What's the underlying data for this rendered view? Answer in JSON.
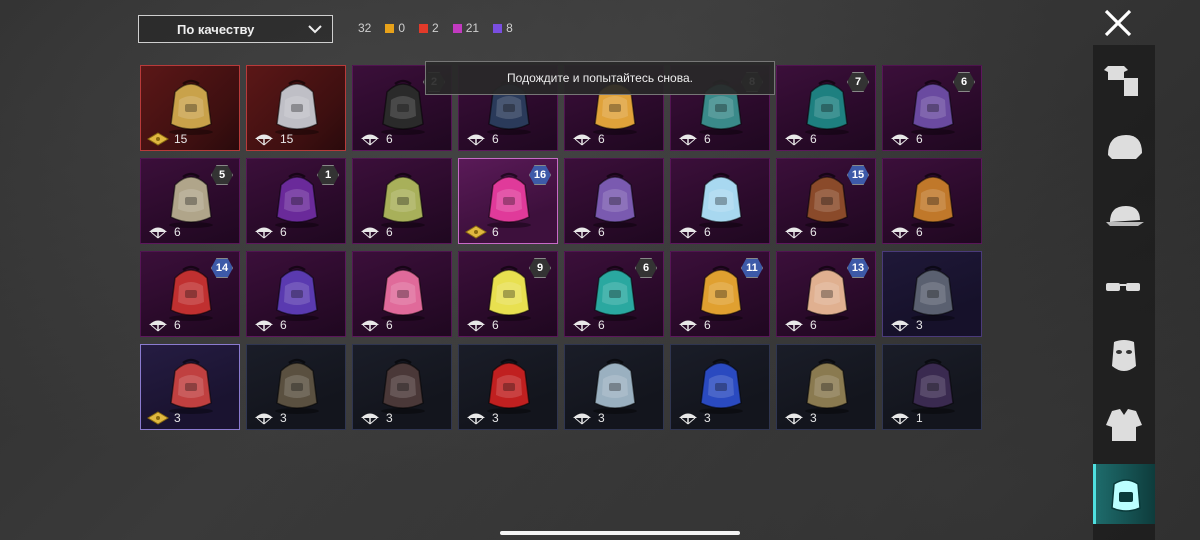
{
  "sort": {
    "label": "По качеству"
  },
  "counts": {
    "total": "32",
    "groups": [
      {
        "value": "0",
        "color": "#e8a21a"
      },
      {
        "value": "2",
        "color": "#e23a2a"
      },
      {
        "value": "21",
        "color": "#c23ac0"
      },
      {
        "value": "8",
        "color": "#7a4ee0"
      }
    ]
  },
  "toast": {
    "text": "Подождите и попытайтесь снова."
  },
  "items": [
    {
      "count": "15",
      "quality": "legendary",
      "currency": "gold",
      "icon": "gold-helmet-emblem",
      "art": "#c9a24a"
    },
    {
      "count": "15",
      "quality": "legendary",
      "currency": "silver",
      "icon": "silver-winged-emblem",
      "art": "#bfbfc6"
    },
    {
      "count": "6",
      "quality": "epic",
      "currency": "silver",
      "icon": "black-pink-backpack",
      "art": "#2a2a2a",
      "level": "2"
    },
    {
      "count": "6",
      "quality": "epic",
      "currency": "silver",
      "icon": "navy-gold-backpack",
      "art": "#2a3a5a"
    },
    {
      "count": "6",
      "quality": "epic",
      "currency": "silver",
      "icon": "bird-costume-backpack",
      "art": "#e0a23a"
    },
    {
      "count": "6",
      "quality": "epic",
      "currency": "silver",
      "icon": "mammoth-backpack",
      "art": "#3a8a8a",
      "level": "8"
    },
    {
      "count": "6",
      "quality": "epic",
      "currency": "silver",
      "icon": "teal-armored-backpack",
      "art": "#1e8080",
      "level": "7"
    },
    {
      "count": "6",
      "quality": "epic",
      "currency": "silver",
      "icon": "purple-shrine-backpack",
      "art": "#6a4aa0",
      "level": "6"
    },
    {
      "count": "6",
      "quality": "epic",
      "currency": "silver",
      "icon": "ornate-beige-backpack",
      "art": "#b0a58a",
      "level": "5"
    },
    {
      "count": "6",
      "quality": "epic",
      "currency": "silver",
      "icon": "purple-cat-backpack",
      "art": "#6a2a9a",
      "level": "1"
    },
    {
      "count": "6",
      "quality": "epic",
      "currency": "silver",
      "icon": "olive-tactical-backpack",
      "art": "#a8b05a"
    },
    {
      "count": "6",
      "quality": "epic-hl",
      "currency": "gold",
      "icon": "pink-robot-backpack",
      "art": "#e03a9a",
      "level": "16"
    },
    {
      "count": "6",
      "quality": "epic",
      "currency": "silver",
      "icon": "purple-ornate-backpack",
      "art": "#7a5ab0"
    },
    {
      "count": "6",
      "quality": "epic",
      "currency": "silver",
      "icon": "snowman-backpack",
      "art": "#a8d8f0"
    },
    {
      "count": "6",
      "quality": "epic",
      "currency": "silver",
      "icon": "camo-orange-backpack",
      "art": "#8a4a2a",
      "level": "15"
    },
    {
      "count": "6",
      "quality": "epic",
      "currency": "silver",
      "icon": "burger-backpack",
      "art": "#c0782a"
    },
    {
      "count": "6",
      "quality": "epic",
      "currency": "silver",
      "icon": "red-turtle-backpack",
      "art": "#c03030",
      "level": "14"
    },
    {
      "count": "6",
      "quality": "epic",
      "currency": "silver",
      "icon": "purple-gold-backpack",
      "art": "#5a3ab0"
    },
    {
      "count": "6",
      "quality": "epic",
      "currency": "silver",
      "icon": "pink-hearts-backpack",
      "art": "#e06a9a"
    },
    {
      "count": "6",
      "quality": "epic",
      "currency": "silver",
      "icon": "bunny-backpack",
      "art": "#e8e050",
      "level": "9"
    },
    {
      "count": "6",
      "quality": "epic",
      "currency": "silver",
      "icon": "teal-dragon-backpack",
      "art": "#2aa8a0",
      "level": "6"
    },
    {
      "count": "6",
      "quality": "epic",
      "currency": "silver",
      "icon": "chicken-backpack",
      "art": "#e0a030",
      "level": "11"
    },
    {
      "count": "6",
      "quality": "epic",
      "currency": "silver",
      "icon": "cake-backpack",
      "art": "#e0b090",
      "level": "13"
    },
    {
      "count": "3",
      "quality": "rare",
      "currency": "silver",
      "icon": "armored-gray-backpack",
      "art": "#5a6070"
    },
    {
      "count": "3",
      "quality": "rare-hl",
      "currency": "gold",
      "icon": "red-graffiti-backpack",
      "art": "#c04040"
    },
    {
      "count": "3",
      "quality": "dark",
      "currency": "silver",
      "icon": "military-brown-backpack",
      "art": "#5a5040"
    },
    {
      "count": "3",
      "quality": "dark",
      "currency": "silver",
      "icon": "dark-brown-backpack",
      "art": "#4a3838"
    },
    {
      "count": "3",
      "quality": "dark",
      "currency": "silver",
      "icon": "red-club-backpack",
      "art": "#c02020"
    },
    {
      "count": "3",
      "quality": "dark",
      "currency": "silver",
      "icon": "pastel-backpack",
      "art": "#9ab0c0"
    },
    {
      "count": "3",
      "quality": "dark",
      "currency": "silver",
      "icon": "blue-yellow-egg-backpack",
      "art": "#2a4ac0"
    },
    {
      "count": "3",
      "quality": "dark",
      "currency": "silver",
      "icon": "sketch-gold-backpack",
      "art": "#8a7a50"
    },
    {
      "count": "1",
      "quality": "dark",
      "currency": "silver",
      "icon": "purple-dark-backpack",
      "art": "#3a2a50"
    }
  ],
  "sidebar": [
    {
      "name": "outfit-icon"
    },
    {
      "name": "helmet-icon"
    },
    {
      "name": "cap-icon"
    },
    {
      "name": "glasses-icon"
    },
    {
      "name": "mask-icon"
    },
    {
      "name": "jacket-icon"
    },
    {
      "name": "backpack-icon",
      "active": true
    }
  ]
}
